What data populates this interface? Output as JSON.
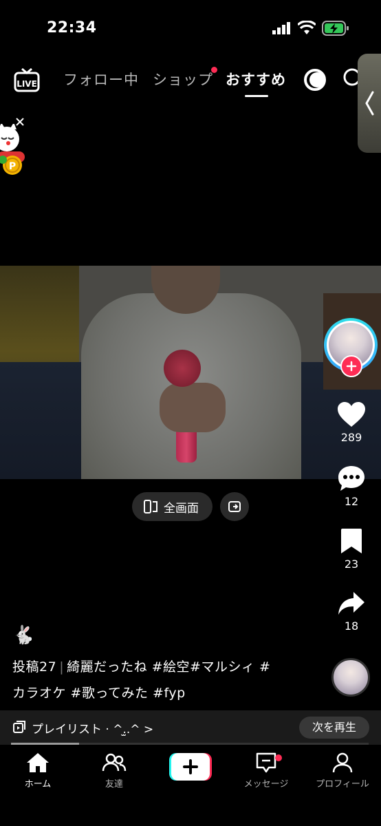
{
  "status_bar": {
    "time": "22:34"
  },
  "top_nav": {
    "live_label": "LIVE",
    "tabs": [
      {
        "label": "フォロー中"
      },
      {
        "label": "ショップ"
      },
      {
        "label": "おすすめ"
      }
    ],
    "active_tab": "おすすめ"
  },
  "video": {
    "fullscreen_label": "全画面"
  },
  "actions": {
    "like_count": "289",
    "comment_count": "12",
    "save_count": "23",
    "share_count": "18"
  },
  "caption": {
    "emoji": "🐇",
    "post_number": "投稿27",
    "separator": "|",
    "text_line1": "綺麗だったね #絵空#マルシィ #",
    "text_line2": "カラオケ #歌ってみた #fyp"
  },
  "playlist": {
    "label": "プレイリスト · ^.̫.^ >",
    "next_button": "次を再生",
    "progress": 0.19
  },
  "bottom_nav": {
    "items": [
      {
        "label": "ホーム",
        "icon": "home-icon"
      },
      {
        "label": "友達",
        "icon": "friends-icon"
      },
      {
        "label": "",
        "icon": "create-plus-icon"
      },
      {
        "label": "メッセージ",
        "icon": "inbox-icon"
      },
      {
        "label": "プロフィール",
        "icon": "profile-icon"
      }
    ]
  },
  "colors": {
    "accent_red": "#fe2c55",
    "avatar_ring": "#2de0e8",
    "background": "#000000"
  }
}
